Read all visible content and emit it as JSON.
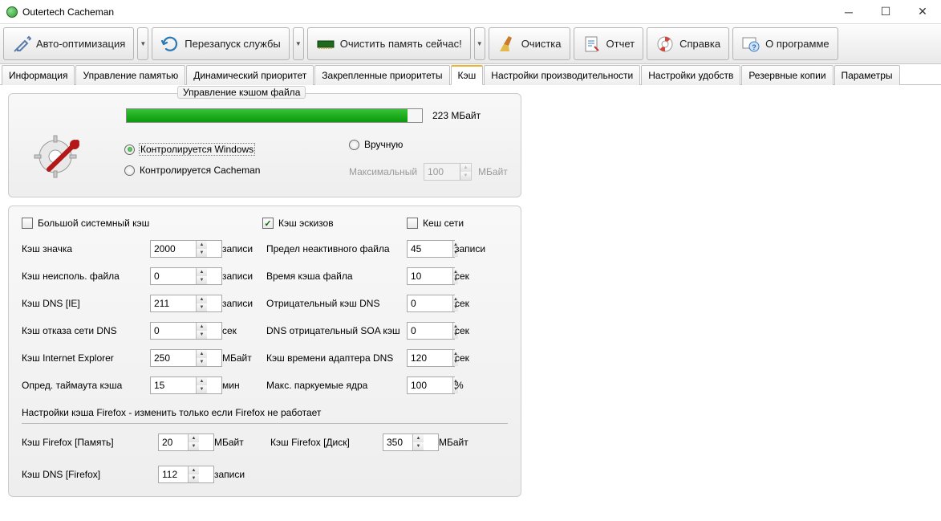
{
  "title": "Outertech Cacheman",
  "toolbar": {
    "auto_opt": "Авто-оптимизация",
    "restart": "Перезапуск службы",
    "clear_mem": "Очистить память сейчас!",
    "clean": "Очистка",
    "report": "Отчет",
    "help": "Справка",
    "about": "О программе"
  },
  "tabs": {
    "info": "Информация",
    "memmgmt": "Управление памятью",
    "dynprio": "Динамический приоритет",
    "pinnedprio": "Закрепленные приоритеты",
    "cache": "Кэш",
    "perf": "Настройки производительности",
    "comfort": "Настройки удобств",
    "backup": "Резервные копии",
    "params": "Параметры"
  },
  "filecache": {
    "legend": "Управление кэшом файла",
    "progress_text": "223 МБайт",
    "r_windows": "Контролируется Windows",
    "r_cacheman": "Контролируется Cacheman",
    "r_manual": "Вручную",
    "max_label": "Максимальный",
    "max_value": "100",
    "max_unit": "МБайт"
  },
  "checks": {
    "big_sys": "Большой системный кэш",
    "thumbs": "Кэш эскизов",
    "net": "Кеш сети"
  },
  "settings": {
    "l_icon": "Кэш значка",
    "v_icon": "2000",
    "u_icon": "записи",
    "l_deadfile": "Предел неактивного файла",
    "v_deadfile": "45",
    "u_deadfile": "записи",
    "l_unused": "Кэш неисполь. файла",
    "v_unused": "0",
    "u_unused": "записи",
    "l_filetime": "Время кэша файла",
    "v_filetime": "10",
    "u_filetime": "сек",
    "l_dnsie": "Кэш DNS [IE]",
    "v_dnsie": "211",
    "u_dnsie": "записи",
    "l_negdns": "Отрицательный кэш DNS",
    "v_negdns": "0",
    "u_negdns": "сек",
    "l_dnsfail": "Кэш отказа сети DNS",
    "v_dnsfail": "0",
    "u_dnsfail": "сек",
    "l_dnssoa": "DNS отрицательный SOA кэш",
    "v_dnssoa": "0",
    "u_dnssoa": "сек",
    "l_ie": "Кэш Internet Explorer",
    "v_ie": "250",
    "u_ie": "МБайт",
    "l_adapter": "Кэш времени адаптера DNS",
    "v_adapter": "120",
    "u_adapter": "сек",
    "l_timeout": "Опред. таймаута кэша",
    "v_timeout": "15",
    "u_timeout": "мин",
    "l_cores": "Макс. паркуемые ядра",
    "v_cores": "100",
    "u_cores": "%"
  },
  "firefox": {
    "note": "Настройки кэша Firefox - изменить только если Firefox не работает",
    "l_mem": "Кэш Firefox [Память]",
    "v_mem": "20",
    "u_mem": "МБайт",
    "l_disk": "Кэш Firefox [Диск]",
    "v_disk": "350",
    "u_disk": "МБайт",
    "l_dns": "Кэш DNS [Firefox]",
    "v_dns": "112",
    "u_dns": "записи"
  }
}
